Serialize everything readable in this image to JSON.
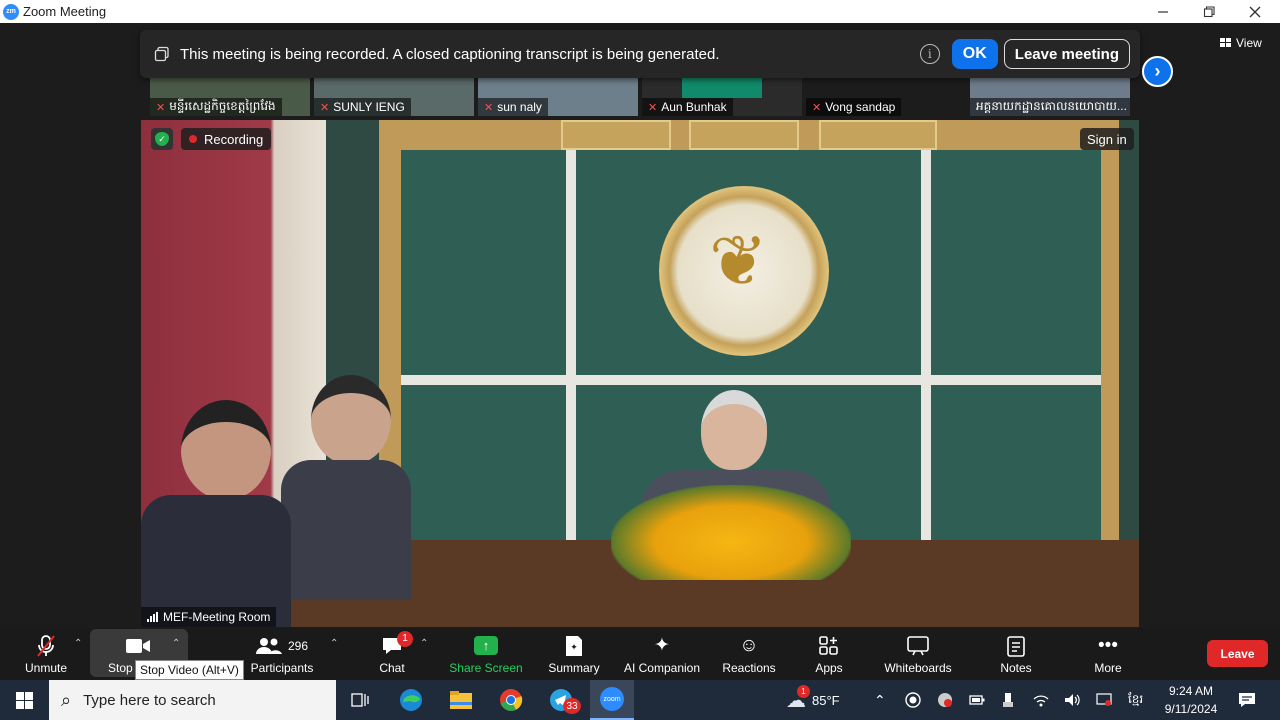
{
  "window": {
    "logo": "zm",
    "title": "Zoom Meeting",
    "minimize_icon": "minimize-icon",
    "restore_icon": "restore-icon",
    "close_icon": "close-icon"
  },
  "banner": {
    "message": "This meeting is being recorded. A closed captioning transcript is being generated.",
    "ok_label": "OK",
    "leave_label": "Leave meeting",
    "info_glyph": "i"
  },
  "view_label": "View",
  "thumbnails": [
    {
      "name": "មន្ទីរសេដ្ឋកិច្ចខេត្តព្រៃវែង",
      "muted": true
    },
    {
      "name": "SUNLY IENG",
      "muted": true
    },
    {
      "name": "sun naly",
      "muted": true
    },
    {
      "name": "Aun Bunhak",
      "muted": true
    },
    {
      "name": "Vong sandap",
      "muted": true
    },
    {
      "name": "អគ្គនាយកដ្ឋានគោលនយោបាយ...",
      "muted": false
    }
  ],
  "video": {
    "recording_label": "Recording",
    "signin_label": "Sign in",
    "room_name": "MEF-Meeting Room"
  },
  "toolbar": {
    "unmute": "Unmute",
    "stop_video": "Stop Video",
    "stop_video_tooltip": "Stop Video (Alt+V)",
    "participants_count": "296",
    "participants": "Participants",
    "chat": "Chat",
    "chat_badge": "1",
    "share": "Share Screen",
    "summary": "Summary",
    "ai": "AI Companion",
    "reactions": "Reactions",
    "apps": "Apps",
    "whiteboards": "Whiteboards",
    "notes": "Notes",
    "more": "More",
    "leave": "Leave"
  },
  "taskbar": {
    "search_placeholder": "Type here to search",
    "telegram_badge": "33",
    "zoom_label": "zoom",
    "weather_badge": "1",
    "temperature": "85°F",
    "time": "9:24 AM",
    "date": "9/11/2024",
    "language": "ខ្មែរ"
  },
  "colors": {
    "accent": "#0e72ed",
    "record": "#e02828",
    "share": "#23b14d"
  }
}
